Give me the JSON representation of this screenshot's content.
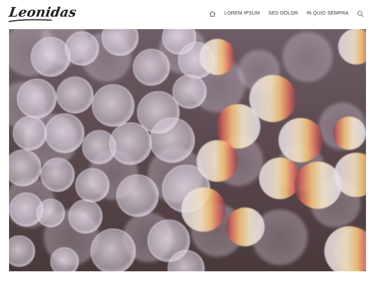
{
  "site": {
    "logo_text": "Leonidas"
  },
  "nav": {
    "home_icon": "home-icon",
    "items": [
      {
        "label": "LOREM IPSUM"
      },
      {
        "label": "SED DOLOR"
      },
      {
        "label": "IN QUID SEMPRA"
      }
    ],
    "search_icon": "search-icon"
  },
  "hero": {
    "image": "bokeh-lights-photo",
    "colors": {
      "background_top": "#6b5a61",
      "background_bottom": "#4a3a3c",
      "bokeh_light": "#ddd6e3",
      "bokeh_warm": "#f3c58a",
      "bokeh_prism_red": "#e2695c"
    }
  }
}
